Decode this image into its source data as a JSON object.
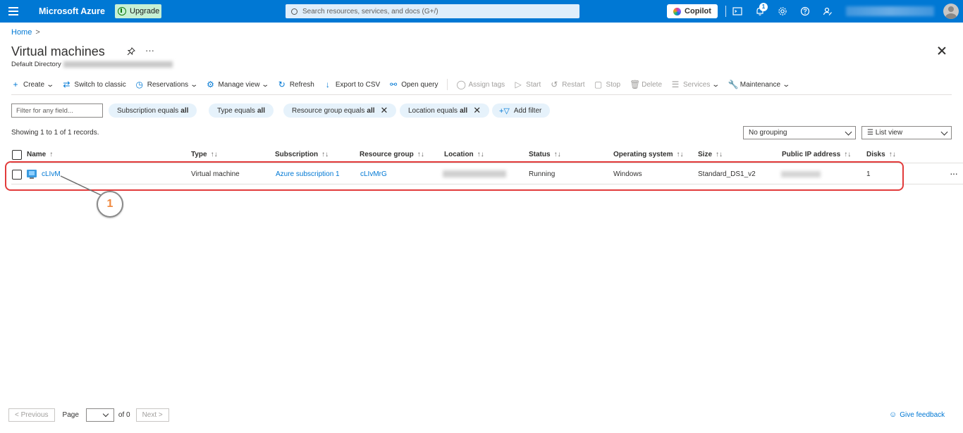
{
  "topbar": {
    "brand": "Microsoft Azure",
    "upgrade_label": "Upgrade",
    "search_placeholder": "Search resources, services, and docs (G+/)",
    "copilot_label": "Copilot",
    "notification_count": "1",
    "icons": [
      "menu-icon",
      "cloud-shell-icon",
      "notifications-icon",
      "settings-icon",
      "help-icon",
      "feedback-icon"
    ]
  },
  "breadcrumb": {
    "home": "Home",
    "separator": ">"
  },
  "page": {
    "title": "Virtual machines",
    "subtitle": "Default Directory"
  },
  "toolbar": {
    "create": "Create",
    "switch_classic": "Switch to classic",
    "reservations": "Reservations",
    "manage_view": "Manage view",
    "refresh": "Refresh",
    "export_csv": "Export to CSV",
    "open_query": "Open query",
    "assign_tags": "Assign tags",
    "start": "Start",
    "restart": "Restart",
    "stop": "Stop",
    "delete": "Delete",
    "services": "Services",
    "maintenance": "Maintenance"
  },
  "filters": {
    "placeholder": "Filter for any field...",
    "pills": [
      {
        "label": "Subscription equals",
        "value": "all"
      },
      {
        "label": "Type equals",
        "value": "all"
      },
      {
        "label": "Resource group equals",
        "value": "all"
      },
      {
        "label": "Location equals",
        "value": "all"
      }
    ],
    "add_filter": "Add filter"
  },
  "records_text": "Showing 1 to 1 of 1 records.",
  "grouping_value": "No grouping",
  "view_value": "List view",
  "table": {
    "columns": [
      "Name",
      "Type",
      "Subscription",
      "Resource group",
      "Location",
      "Status",
      "Operating system",
      "Size",
      "Public IP address",
      "Disks"
    ],
    "rows": [
      {
        "name": "cLIvM",
        "type": "Virtual machine",
        "subscription": "Azure subscription 1",
        "resource_group": "cLIvMrG",
        "status": "Running",
        "os": "Windows",
        "size": "Standard_DS1_v2",
        "disks": "1"
      }
    ]
  },
  "callout_number": "1",
  "highlight_color": "#e23b3b",
  "pager": {
    "previous": "< Previous",
    "page_label": "Page",
    "of_label": "of 0",
    "next": "Next >"
  },
  "feedback_label": "Give feedback"
}
